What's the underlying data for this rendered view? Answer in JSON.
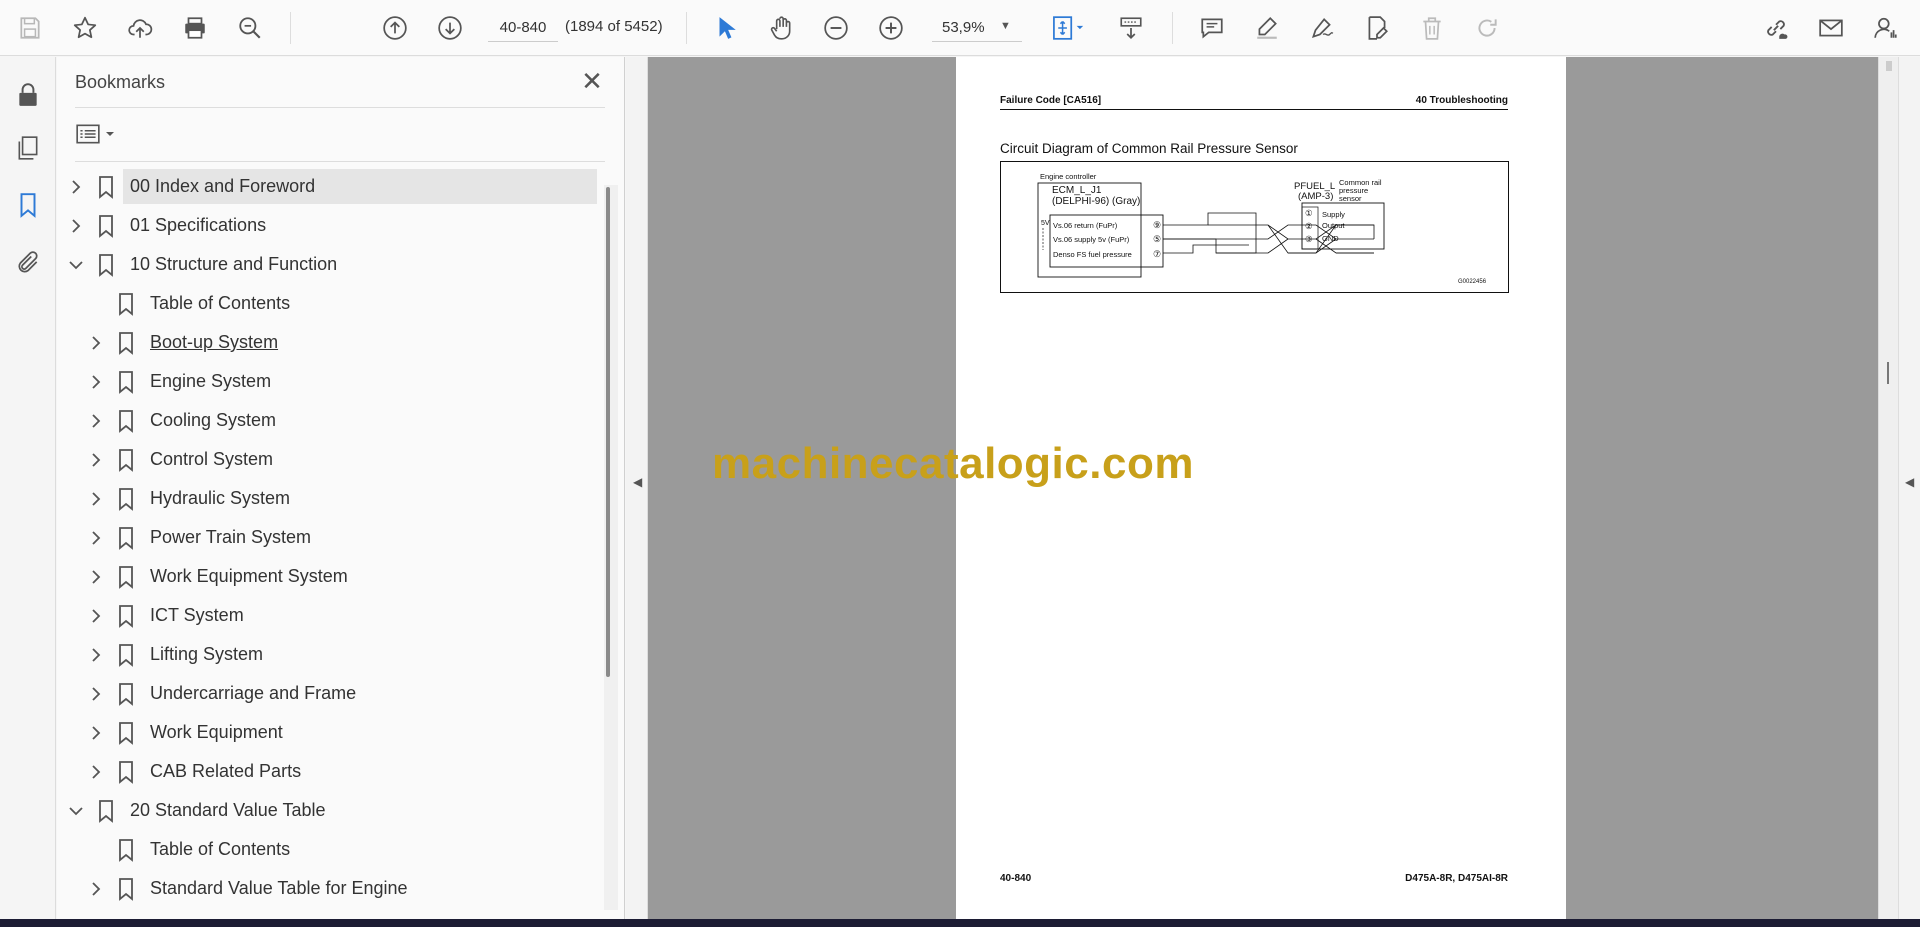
{
  "toolbar": {
    "page_input_value": "40-840",
    "page_count": "(1894 of 5452)",
    "zoom_value": "53,9%",
    "icons": [
      "save-icon",
      "star-icon",
      "upload-icon",
      "print-icon",
      "search-zoom-icon",
      "page-up-icon",
      "page-down-icon",
      "zoom-out-icon",
      "zoom-in-icon",
      "select-cursor-icon",
      "hand-icon",
      "fit-page-icon",
      "scroll-mode-icon",
      "comment-icon",
      "highlight-icon",
      "sign-icon",
      "edit-pdf-icon",
      "delete-icon",
      "redo-icon",
      "share-link-icon",
      "mail-icon",
      "account-icon"
    ]
  },
  "bookmarks": {
    "title": "Bookmarks",
    "close_label": "✕",
    "items": [
      {
        "label": "00 Index and Foreword",
        "expanded": false,
        "level": 0,
        "selected": true
      },
      {
        "label": "01 Specifications",
        "expanded": false,
        "level": 0
      },
      {
        "label": "10 Structure and Function",
        "expanded": true,
        "level": 0
      },
      {
        "label": "Table of Contents",
        "expanded": null,
        "level": 1
      },
      {
        "label": "Boot-up System",
        "expanded": false,
        "level": 1,
        "hovered": true
      },
      {
        "label": "Engine System",
        "expanded": false,
        "level": 1
      },
      {
        "label": "Cooling System",
        "expanded": false,
        "level": 1
      },
      {
        "label": "Control System",
        "expanded": false,
        "level": 1
      },
      {
        "label": "Hydraulic System",
        "expanded": false,
        "level": 1
      },
      {
        "label": "Power Train System",
        "expanded": false,
        "level": 1
      },
      {
        "label": "Work Equipment System",
        "expanded": false,
        "level": 1
      },
      {
        "label": "ICT System",
        "expanded": false,
        "level": 1
      },
      {
        "label": "Lifting System",
        "expanded": false,
        "level": 1
      },
      {
        "label": "Undercarriage and Frame",
        "expanded": false,
        "level": 1
      },
      {
        "label": "Work Equipment",
        "expanded": false,
        "level": 1
      },
      {
        "label": "CAB Related Parts",
        "expanded": false,
        "level": 1
      },
      {
        "label": "20 Standard Value Table",
        "expanded": true,
        "level": 0
      },
      {
        "label": "Table of Contents",
        "expanded": null,
        "level": 1
      },
      {
        "label": "Standard Value Table for Engine",
        "expanded": false,
        "level": 1
      }
    ]
  },
  "document": {
    "header_left": "Failure Code [CA516]",
    "header_right": "40 Troubleshooting",
    "diagram_title": "Circuit Diagram of Common Rail Pressure Sensor",
    "diagram": {
      "engine_controller": "Engine controller",
      "ecm": "ECM_L_J1",
      "ecm_type": "(DELPHI-96)  (Gray)",
      "voltage": "5V",
      "pins_left": [
        "Vs.06 return (FuPr)",
        "Vs.06 supply 5v (FuPr)",
        "Denso FS fuel pressure"
      ],
      "pin_numbers_left": [
        "⑨",
        "⑤",
        "⑦"
      ],
      "sensor_connector": "PFUEL_L",
      "sensor_connector_type": "(AMP-3)",
      "sensor_name_1": "Common rail",
      "sensor_name_2": "pressure",
      "sensor_name_3": "sensor",
      "pins_right": [
        "Supply",
        "Output",
        "GND"
      ],
      "pin_numbers_right": [
        "①",
        "②",
        "③"
      ],
      "ref_code": "G0022456"
    },
    "footer_left": "40-840",
    "footer_right": "D475A-8R, D475AI-8R",
    "watermark": "machinecatalogic.com"
  }
}
